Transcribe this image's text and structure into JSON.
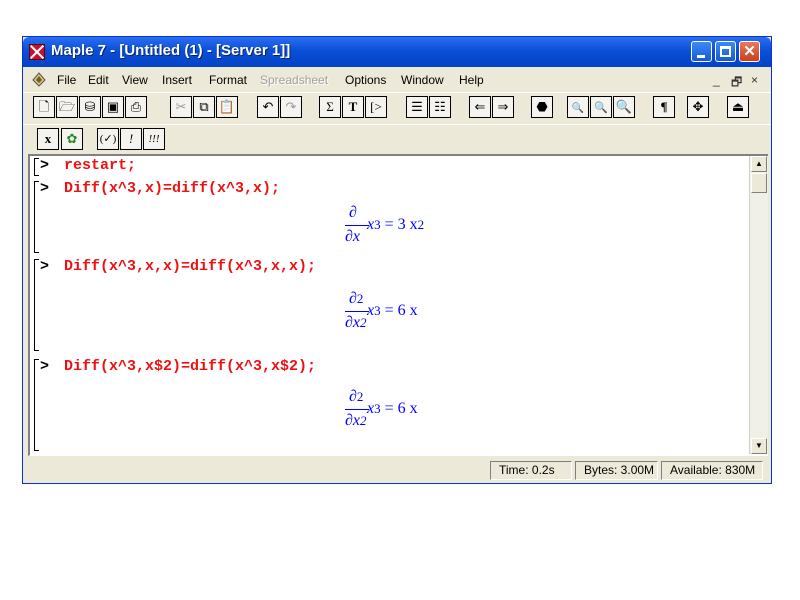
{
  "window": {
    "title": "Maple 7  - [Untitled (1) - [Server 1]]",
    "titlebar_color": "#0a4fd8",
    "caption_buttons": [
      "minimize",
      "maximize",
      "close"
    ]
  },
  "menu": {
    "items": [
      "File",
      "Edit",
      "View",
      "Insert",
      "Format",
      "Spreadsheet",
      "Options",
      "Window",
      "Help"
    ],
    "mdi_minimize": "_",
    "mdi_restore": "🗗",
    "mdi_close": "×"
  },
  "toolbar1": {
    "icons": [
      "new-icon",
      "open-icon",
      "open-url-icon",
      "save-icon",
      "print-icon",
      "cut-icon",
      "copy-icon",
      "paste-icon",
      "undo-icon",
      "redo-icon",
      "sigma-icon",
      "text-icon",
      "prompt-icon",
      "indent-icon",
      "outdent-icon",
      "back-icon",
      "forward-icon",
      "stop-icon",
      "zoom-100-icon",
      "zoom-150-icon",
      "zoom-200-icon",
      "pilcrow-icon",
      "expand-icon",
      "restart-icon"
    ],
    "labels": {
      "sigma": "Σ",
      "text": "T",
      "prompt": "[>",
      "pilcrow": "¶",
      "back": "⇐",
      "forward": "⇒"
    }
  },
  "toolbar2": {
    "labels": [
      "x",
      "✿",
      "(✓)",
      "!",
      "!!!"
    ]
  },
  "worksheet": {
    "prompt_symbol": ">",
    "commands": [
      "restart;",
      "Diff(x^3,x)=diff(x^3,x);",
      "Diff(x^3,x,x)=diff(x^3,x,x);",
      "Diff(x^3,x$2)=diff(x^3,x$2);"
    ],
    "outputs": [
      {
        "numerator": "∂",
        "num_power": "",
        "denominator": "∂x",
        "den_power": "",
        "lhs": "x",
        "lhs_power": "3",
        "rhs": "= 3 x",
        "rhs_power": "2"
      },
      {
        "numerator": "∂",
        "num_power": "2",
        "denominator": "∂x",
        "den_power": "2",
        "lhs": "x",
        "lhs_power": "3",
        "rhs": "= 6 x",
        "rhs_power": ""
      },
      {
        "numerator": "∂",
        "num_power": "2",
        "denominator": "∂x",
        "den_power": "2",
        "lhs": "x",
        "lhs_power": "3",
        "rhs": "= 6 x",
        "rhs_power": ""
      }
    ],
    "command_color": "#ee1111",
    "output_color": "#0000ff"
  },
  "status": {
    "time": "Time:   0.2s",
    "bytes": "Bytes: 3.00M",
    "available": "Available: 830M"
  }
}
